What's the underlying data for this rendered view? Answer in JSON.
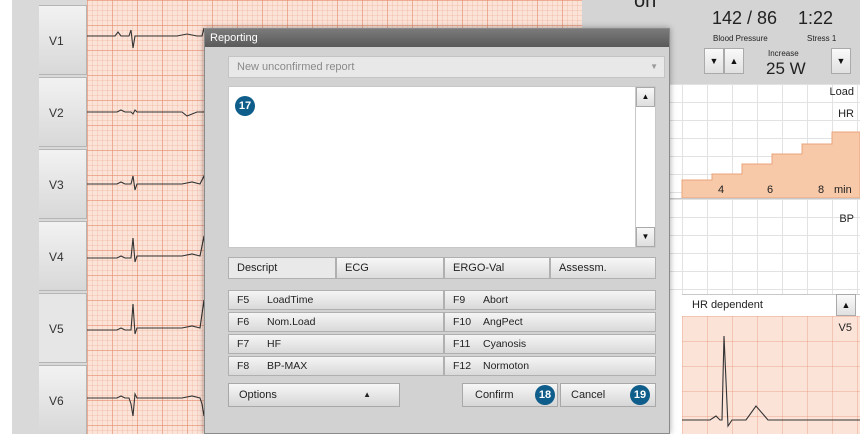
{
  "leads": [
    "V1",
    "V2",
    "V3",
    "V4",
    "V5",
    "V6"
  ],
  "monitor": {
    "phase_partial": "on",
    "bp_value": "142 / 86",
    "bp_label": "Blood Pressure",
    "time_value": "1:22",
    "time_label": "Stress 1",
    "increase_label": "Increase",
    "load_value": "25 W",
    "trend_labels": {
      "load": "Load",
      "hr": "HR",
      "bp": "BP"
    },
    "x_ticks": [
      "4",
      "6",
      "8"
    ],
    "x_unit": "min",
    "hr_dependent": "HR dependent",
    "lead_label": "V5",
    "time_partial": "1:22"
  },
  "dialog": {
    "title": "Reporting",
    "report_select": "New unconfirmed report",
    "tabs": [
      "Descript",
      "ECG",
      "ERGO-Val",
      "Assessm."
    ],
    "keys_left": [
      {
        "key": "F5",
        "label": "LoadTime"
      },
      {
        "key": "F6",
        "label": "Nom.Load"
      },
      {
        "key": "F7",
        "label": "HF"
      },
      {
        "key": "F8",
        "label": "BP-MAX"
      }
    ],
    "keys_right": [
      {
        "key": "F9",
        "label": "Abort"
      },
      {
        "key": "F10",
        "label": "AngPect"
      },
      {
        "key": "F11",
        "label": "Cyanosis"
      },
      {
        "key": "F12",
        "label": "Normoton"
      }
    ],
    "options_label": "Options",
    "confirm_label": "Confirm",
    "cancel_label": "Cancel",
    "callouts": {
      "text_area": "17",
      "confirm": "18",
      "cancel": "19"
    }
  },
  "colors": {
    "callout": "#0f5d8a",
    "ecg_grid": "#fbe3d8",
    "trend_fill": "#f7c9a8"
  }
}
